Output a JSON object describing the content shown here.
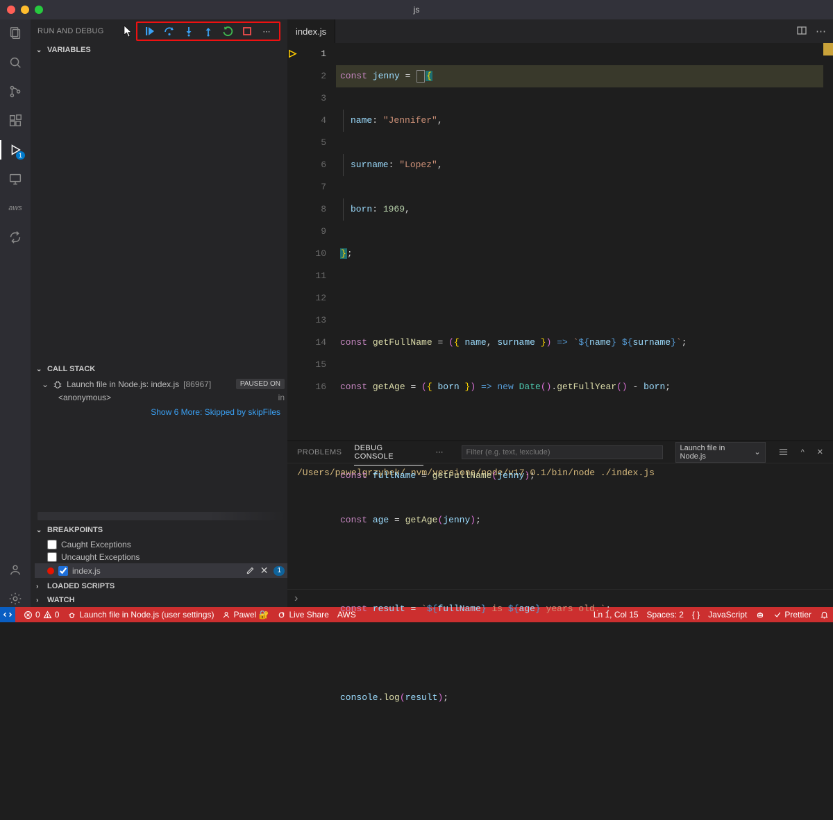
{
  "window": {
    "title": "js"
  },
  "activity": {
    "items": [
      "explorer",
      "search",
      "source-control",
      "extensions",
      "run-debug",
      "remote",
      "aws",
      "share"
    ],
    "active": "run-debug",
    "debug_badge": "1"
  },
  "sidebar": {
    "title": "RUN AND DEBUG",
    "sections": {
      "variables": {
        "label": "VARIABLES"
      },
      "callstack": {
        "label": "CALL STACK",
        "session": "Launch file in Node.js: index.js",
        "pid": "[86967]",
        "state": "PAUSED ON",
        "frame": "<anonymous>",
        "frame_right": "in",
        "more": "Show 6 More: Skipped by skipFiles"
      },
      "breakpoints": {
        "label": "BREAKPOINTS",
        "items": [
          {
            "checked": false,
            "label": "Caught Exceptions",
            "file": false
          },
          {
            "checked": false,
            "label": "Uncaught Exceptions",
            "file": false
          },
          {
            "checked": true,
            "label": "index.js",
            "file": true,
            "badge": "1"
          }
        ]
      },
      "loaded": {
        "label": "LOADED SCRIPTS"
      },
      "watch": {
        "label": "WATCH"
      }
    },
    "debug_toolbar": [
      "continue",
      "step-over",
      "step-into",
      "step-out",
      "restart",
      "stop",
      "more"
    ]
  },
  "tabs": {
    "active": "index.js"
  },
  "editor": {
    "lines": [
      {
        "n": 1,
        "bp": true
      },
      {
        "n": 2
      },
      {
        "n": 3
      },
      {
        "n": 4
      },
      {
        "n": 5
      },
      {
        "n": 6
      },
      {
        "n": 7
      },
      {
        "n": 8
      },
      {
        "n": 9
      },
      {
        "n": 10
      },
      {
        "n": 11
      },
      {
        "n": 12
      },
      {
        "n": 13
      },
      {
        "n": 14
      },
      {
        "n": 15
      },
      {
        "n": 16
      }
    ],
    "content": {
      "l1_const": "const",
      "l1_var": "jenny",
      "l1_eq": " = ",
      "l2_key": "name",
      "l2_val": "\"Jennifer\"",
      "l3_key": "surname",
      "l3_val": "\"Lopez\"",
      "l4_key": "born",
      "l4_val": "1969",
      "l7": "const getFullName = ({ name, surname }) => `${name} ${surname}`;",
      "l8": "const getAge = ({ born }) => new Date().getFullYear() - born;",
      "l10": "const fullName = getFullName(jenny);",
      "l11": "const age = getAge(jenny);",
      "l13": "const result = `${fullName} is ${age} years old.`;",
      "l15": "console.log(result);"
    }
  },
  "panel": {
    "tabs": {
      "problems": "PROBLEMS",
      "debug_console": "DEBUG CONSOLE"
    },
    "filter_placeholder": "Filter (e.g. text, !exclude)",
    "launch_selector": "Launch file in Node.js",
    "output": "/Users/pawelgrzybek/.nvm/versions/node/v17.0.1/bin/node ./index.js"
  },
  "status": {
    "errors": "0",
    "warnings": "0",
    "launch": "Launch file in Node.js (user settings)",
    "user": "Pawel 🔐",
    "liveshare": "Live Share",
    "aws": "AWS",
    "cursor": "Ln 1, Col 15",
    "spaces": "Spaces: 2",
    "encoding": "{ }",
    "lang": "JavaScript",
    "prettier": "Prettier"
  }
}
